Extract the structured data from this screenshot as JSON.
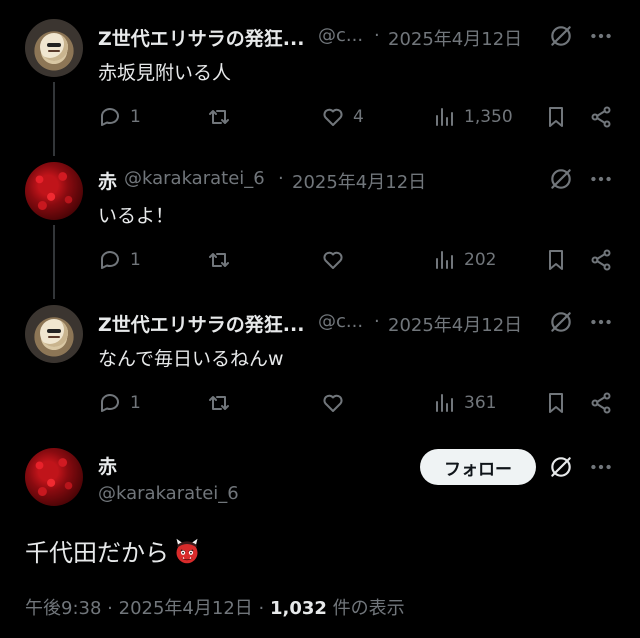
{
  "thread": [
    {
      "author": {
        "name": "Z世代エリサラの発狂...",
        "handle": "@c...",
        "sep": "·",
        "date": "2025年4月12日"
      },
      "text": "赤坂見附いる人",
      "actions": {
        "replies": "1",
        "likes": "4",
        "views": "1,350"
      }
    },
    {
      "author": {
        "name": "赤",
        "handle": "@karakaratei_6",
        "sep": "·",
        "date": "2025年4月12日"
      },
      "text": "いるよ！",
      "actions": {
        "replies": "1",
        "views": "202"
      }
    },
    {
      "author": {
        "name": "Z世代エリサラの発狂...",
        "handle": "@c...",
        "sep": "·",
        "date": "2025年4月12日"
      },
      "text": "なんで毎日いるねんw",
      "actions": {
        "replies": "1",
        "views": "361"
      }
    }
  ],
  "main_post": {
    "author": {
      "name": "赤",
      "handle": "@karakaratei_6"
    },
    "follow_label": "フォロー",
    "text": "千代田だから",
    "emoji_icon": "japanese-ogre-emoji",
    "footer": {
      "time": "午後9:38",
      "sep1": "·",
      "date": "2025年4月12日",
      "sep2": "·",
      "views": "1,032",
      "views_suffix": "件の表示"
    }
  },
  "icons": [
    "grok-icon",
    "more-icon",
    "reply-icon",
    "repost-icon",
    "like-icon",
    "views-icon",
    "bookmark-icon",
    "share-icon"
  ],
  "colors": {
    "background": "#000000",
    "text": "#e7e9ea",
    "muted": "#71767b",
    "follow_bg": "#eff3f4"
  }
}
